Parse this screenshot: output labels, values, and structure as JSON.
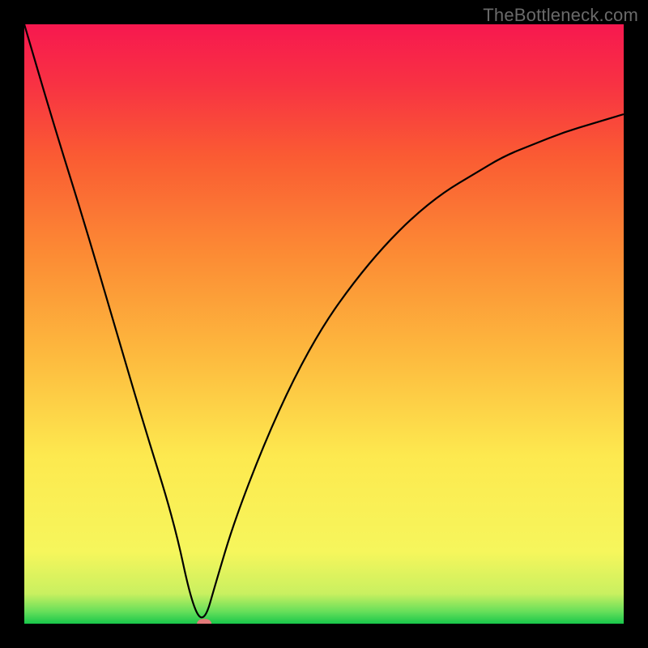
{
  "watermark": {
    "text": "TheBottleneck.com"
  },
  "chart_data": {
    "type": "line",
    "title": "",
    "xlabel": "",
    "ylabel": "",
    "xlim": [
      0,
      100
    ],
    "ylim": [
      0,
      100
    ],
    "grid": false,
    "legend": false,
    "series": [
      {
        "name": "bottleneck-curve",
        "x": [
          0,
          5,
          10,
          15,
          20,
          25,
          28,
          30,
          32,
          35,
          40,
          45,
          50,
          55,
          60,
          65,
          70,
          75,
          80,
          85,
          90,
          95,
          100
        ],
        "values": [
          100,
          83,
          67,
          50,
          33,
          17,
          3,
          0,
          7,
          17,
          30,
          41,
          50,
          57,
          63,
          68,
          72,
          75,
          78,
          80,
          82,
          83.5,
          85
        ]
      }
    ],
    "marker": {
      "x": 30,
      "y": 0,
      "color": "#e27a7a",
      "width_pct": 2.4,
      "height_pct": 1.6
    },
    "background_gradient": {
      "direction": "to top",
      "stops": [
        {
          "pos": 0,
          "color": "#18c74b"
        },
        {
          "pos": 2,
          "color": "#66df5a"
        },
        {
          "pos": 5,
          "color": "#c9f060"
        },
        {
          "pos": 12,
          "color": "#f6f65c"
        },
        {
          "pos": 28,
          "color": "#fde94f"
        },
        {
          "pos": 45,
          "color": "#fdb93e"
        },
        {
          "pos": 62,
          "color": "#fc8a34"
        },
        {
          "pos": 78,
          "color": "#fa5b33"
        },
        {
          "pos": 90,
          "color": "#f83243"
        },
        {
          "pos": 100,
          "color": "#f7184f"
        }
      ]
    },
    "line_style": {
      "stroke": "#000000",
      "width": 2.2
    }
  }
}
